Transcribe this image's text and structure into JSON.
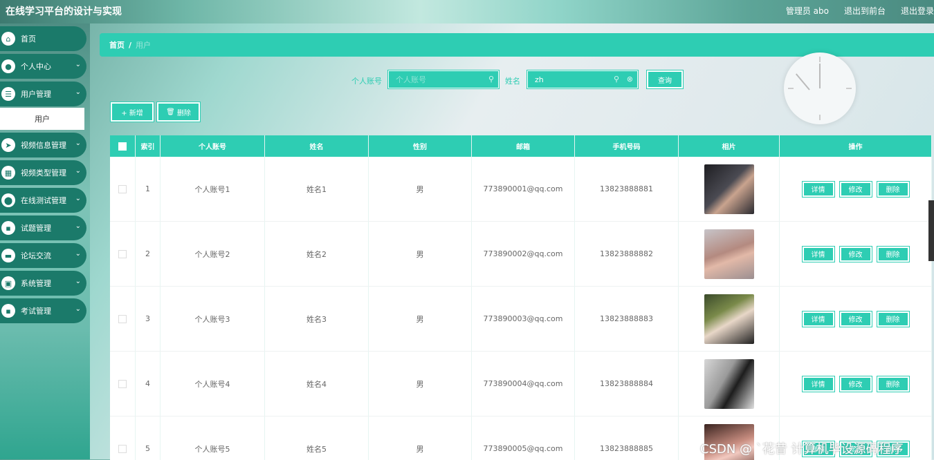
{
  "header": {
    "title": "在线学习平台的设计与实现",
    "links": [
      "管理员 abo",
      "退出到前台",
      "退出登录"
    ]
  },
  "sidebar": {
    "items": [
      {
        "label": "首页",
        "icon": "home-icon",
        "chevron": false
      },
      {
        "label": "个人中心",
        "icon": "user-icon",
        "chevron": true
      },
      {
        "label": "用户管理",
        "icon": "sliders-icon",
        "chevron": true,
        "sub": "用户"
      },
      {
        "label": "视频信息管理",
        "icon": "send-icon",
        "chevron": true
      },
      {
        "label": "视频类型管理",
        "icon": "grid-icon",
        "chevron": true
      },
      {
        "label": "在线测试管理",
        "icon": "pin-icon",
        "chevron": true
      },
      {
        "label": "试题管理",
        "icon": "apps-icon",
        "chevron": true
      },
      {
        "label": "论坛交流",
        "icon": "chat-icon",
        "chevron": true
      },
      {
        "label": "系统管理",
        "icon": "briefcase-icon",
        "chevron": true
      },
      {
        "label": "考试管理",
        "icon": "apps-icon",
        "chevron": true
      }
    ]
  },
  "breadcrumb": {
    "home": "首页",
    "sep": "/",
    "current": "用户"
  },
  "search": {
    "account_label": "个人账号",
    "account_placeholder": "个人账号",
    "name_label": "姓名",
    "name_value": "zh",
    "query_button": "查询"
  },
  "toolbar": {
    "add": "+ 新增",
    "delete": "删除"
  },
  "table": {
    "headers": [
      "索引",
      "个人账号",
      "姓名",
      "性别",
      "邮箱",
      "手机号码",
      "相片",
      "操作"
    ],
    "rows": [
      {
        "index": "1",
        "account": "个人账号1",
        "name": "姓名1",
        "gender": "男",
        "email": "773890001@qq.com",
        "phone": "13823888881"
      },
      {
        "index": "2",
        "account": "个人账号2",
        "name": "姓名2",
        "gender": "男",
        "email": "773890002@qq.com",
        "phone": "13823888882"
      },
      {
        "index": "3",
        "account": "个人账号3",
        "name": "姓名3",
        "gender": "男",
        "email": "773890003@qq.com",
        "phone": "13823888883"
      },
      {
        "index": "4",
        "account": "个人账号4",
        "name": "姓名4",
        "gender": "男",
        "email": "773890004@qq.com",
        "phone": "13823888884"
      },
      {
        "index": "5",
        "account": "个人账号5",
        "name": "姓名5",
        "gender": "男",
        "email": "773890005@qq.com",
        "phone": "13823888885"
      }
    ],
    "actions": [
      "详情",
      "修改",
      "删除"
    ]
  },
  "watermark": "CSDN @ `花昔  计算机毕设源码程序",
  "colors": {
    "accent": "#2ecdb3",
    "sidebar_item": "#1b7a6a"
  }
}
